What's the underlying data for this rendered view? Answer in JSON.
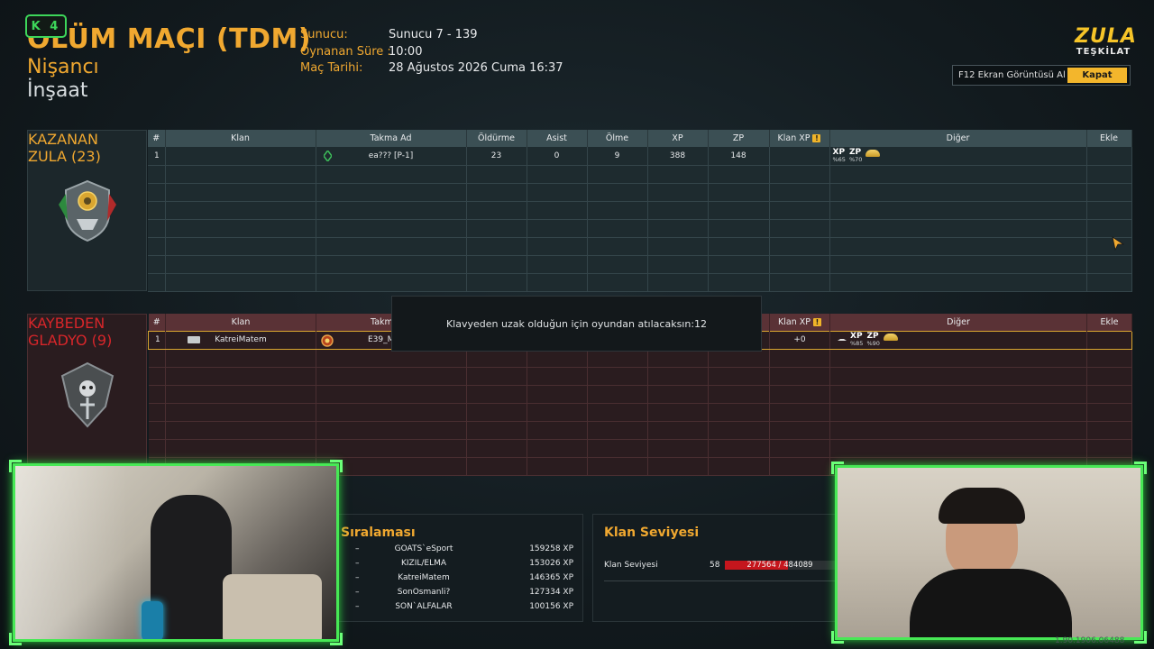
{
  "header": {
    "badge": "K 4",
    "mode_title": "ÖLÜM MAÇI (TDM)",
    "role": "Nişancı",
    "map": "İnşaat",
    "server_label": "Sunucu:",
    "server_value": "Sunucu 7 - 139",
    "duration_label": "Oynanan Süre :",
    "duration_value": "10:00",
    "date_label": "Maç Tarihi:",
    "date_value": "28 Ağustos 2026 Cuma 16:37"
  },
  "logo": {
    "line1": "ZULA",
    "line2": "TEŞKİLAT"
  },
  "screenshot": {
    "hint": "F12 Ekran Görüntüsü Al",
    "close_label": "Kapat"
  },
  "columns": [
    "#",
    "Klan",
    "Takma Ad",
    "Öldürme",
    "Asist",
    "Ölme",
    "XP",
    "ZP",
    "Klan XP",
    "Diğer",
    "Ekle"
  ],
  "winner": {
    "status": "KAZANAN",
    "team_name": "ZULA (23)",
    "rows": [
      {
        "rank": "1",
        "clan": "",
        "nickname": "ea??? [P-1]",
        "kills": "23",
        "assists": "0",
        "deaths": "9",
        "xp": "388",
        "zp": "148",
        "clan_xp": "",
        "xp_label": "XP",
        "xp_pct": "%65",
        "zp_label": "ZP",
        "zp_pct": "%70"
      }
    ]
  },
  "loser": {
    "status": "KAYBEDEN",
    "team_name": "GLADYO (9)",
    "rows": [
      {
        "rank": "1",
        "clan": "KatreiMatem",
        "nickname": "E39_M",
        "clan_xp": "+0",
        "xp_label": "XP",
        "xp_pct": "%85",
        "zp_label": "ZP",
        "zp_pct": "%90"
      }
    ]
  },
  "afk_message": "Klavyeden uzak olduğun için oyundan atılacaksın:12",
  "ranking": {
    "title": "Sıralaması",
    "rows": [
      {
        "pos": "–",
        "name": "GOATS`eSport",
        "xp": "159258 XP"
      },
      {
        "pos": "–",
        "name": "KIZIL/ELMA",
        "xp": "153026 XP"
      },
      {
        "pos": "–",
        "name": "KatreiMatem",
        "xp": "146365 XP"
      },
      {
        "pos": "–",
        "name": "SonOsmanli?",
        "xp": "127334 XP"
      },
      {
        "pos": "–",
        "name": "SON`ALFALAR",
        "xp": "100156 XP"
      }
    ]
  },
  "clan_level": {
    "title": "Klan Seviyesi",
    "label": "Klan Seviyesi",
    "level": "58",
    "progress_text": "277564 / 484089",
    "progress_fraction": 0.573
  },
  "version": "1.90.1906.06488",
  "colors": {
    "accent": "#f0a830",
    "cam_border": "#47e855",
    "level_bar": "#c5161d"
  }
}
